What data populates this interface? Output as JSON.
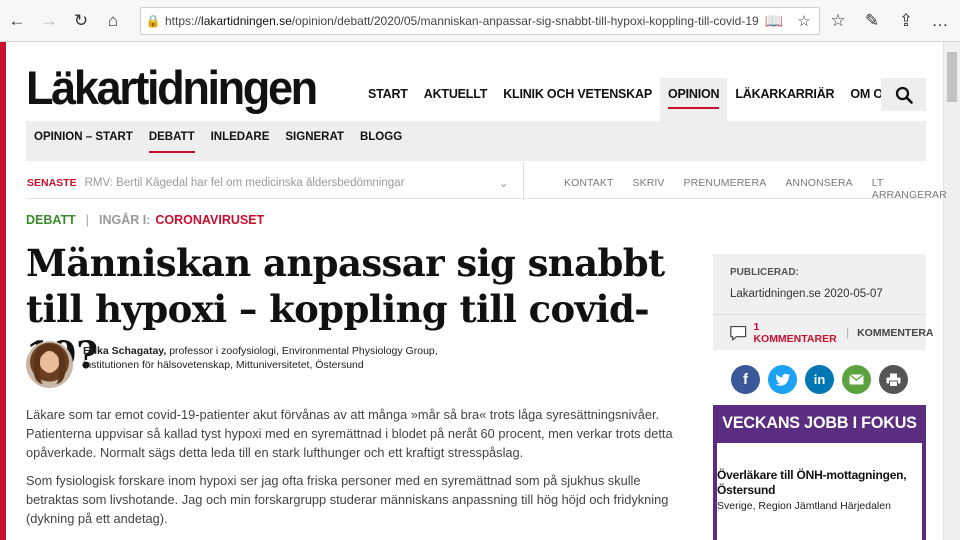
{
  "browser": {
    "url_prefix": "https://",
    "url_domain": "lakartidningen.se",
    "url_path": "/opinion/debatt/2020/05/manniskan-anpassar-sig-snabbt-till-hypoxi-koppling-till-covid-19/"
  },
  "site": {
    "logo": "Läkartidningen",
    "main_nav": [
      "START",
      "AKTUELLT",
      "KLINIK OCH VETENSKAP",
      "OPINION",
      "LÄKARKARRIÄR",
      "OM OSS"
    ],
    "sub_nav": [
      "OPINION – START",
      "DEBATT",
      "INLEDARE",
      "SIGNERAT",
      "BLOGG"
    ],
    "latest_tag": "SENASTE",
    "latest_headline": "RMV: Bertil Kågedal har fel om medicinska åldersbedömningar",
    "top_links": [
      "KONTAKT",
      "SKRIV",
      "PRENUMERERA",
      "ANNONSERA",
      "LT ARRANGERAR"
    ]
  },
  "article": {
    "category": "DEBATT",
    "part_of": "INGÅR I:",
    "theme": "CORONAVIRUSET",
    "title": "Människan anpassar sig snabbt till hypoxi – koppling till covid-19?",
    "author_name": "Erika Schagatay,",
    "author_desc1": " professor i zoofysiologi, Environmental Physiology Group,",
    "author_desc2": "institutionen för hälsovetenskap, Mittuniversitetet, Östersund",
    "para1": "Läkare som tar emot covid-19-patienter akut förvånas av att många »mår så bra« trots låga syresättningsnivåer. Patienterna uppvisar så kallad tyst hypoxi med en syremättnad i blodet på neråt 60 procent, men verkar trots detta opåverkade. Normalt sägs detta leda till en stark lufthunger och ett kraftigt stresspåslag.",
    "para2": "Som fysiologisk forskare inom hypoxi ser jag ofta friska personer med en syremättnad som på sjukhus skulle betraktas som livshotande. Jag och min forskargrupp studerar människans anpassning till hög höjd och fridykning (dykning på ett andetag)."
  },
  "sidebar": {
    "published_label": "PUBLICERAD:",
    "published_value": "Lakartidningen.se 2020-05-07",
    "comments_count": "1 KOMMENTARER",
    "comment_write": "KOMMENTERA",
    "share": [
      {
        "name": "facebook",
        "glyph": "f",
        "color": "#3b5998"
      },
      {
        "name": "twitter",
        "glyph": "t",
        "color": "#1da1f2"
      },
      {
        "name": "linkedin",
        "glyph": "in",
        "color": "#0077b5"
      },
      {
        "name": "email",
        "glyph": "✉",
        "color": "#5aa33f"
      },
      {
        "name": "print",
        "glyph": "⎙",
        "color": "#555555"
      }
    ],
    "jobs_title": "VECKANS JOBB I FOKUS",
    "job_title": "Överläkare till ÖNH-mottagningen, Östersund",
    "job_location": "Sverige, Region Jämtland Härjedalen"
  },
  "colors": {
    "accent": "#c8102e",
    "green": "#3b8a2b",
    "purple": "#5a2d81"
  }
}
